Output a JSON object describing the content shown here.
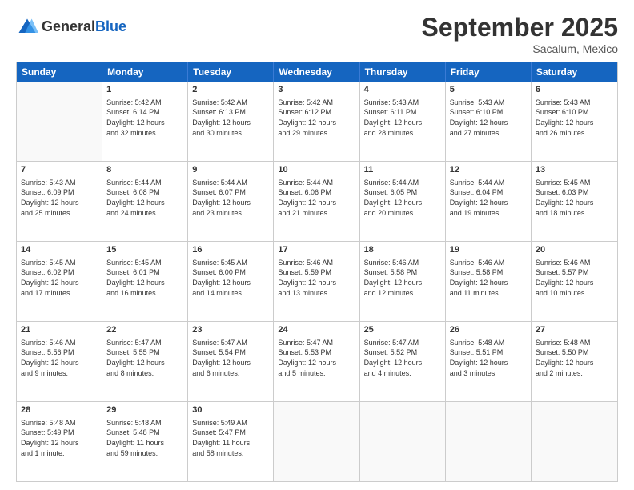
{
  "header": {
    "logo_line1": "General",
    "logo_line2": "Blue",
    "month": "September 2025",
    "location": "Sacalum, Mexico"
  },
  "days_of_week": [
    "Sunday",
    "Monday",
    "Tuesday",
    "Wednesday",
    "Thursday",
    "Friday",
    "Saturday"
  ],
  "weeks": [
    [
      {
        "day": "",
        "info": ""
      },
      {
        "day": "1",
        "info": "Sunrise: 5:42 AM\nSunset: 6:14 PM\nDaylight: 12 hours\nand 32 minutes."
      },
      {
        "day": "2",
        "info": "Sunrise: 5:42 AM\nSunset: 6:13 PM\nDaylight: 12 hours\nand 30 minutes."
      },
      {
        "day": "3",
        "info": "Sunrise: 5:42 AM\nSunset: 6:12 PM\nDaylight: 12 hours\nand 29 minutes."
      },
      {
        "day": "4",
        "info": "Sunrise: 5:43 AM\nSunset: 6:11 PM\nDaylight: 12 hours\nand 28 minutes."
      },
      {
        "day": "5",
        "info": "Sunrise: 5:43 AM\nSunset: 6:10 PM\nDaylight: 12 hours\nand 27 minutes."
      },
      {
        "day": "6",
        "info": "Sunrise: 5:43 AM\nSunset: 6:10 PM\nDaylight: 12 hours\nand 26 minutes."
      }
    ],
    [
      {
        "day": "7",
        "info": "Sunrise: 5:43 AM\nSunset: 6:09 PM\nDaylight: 12 hours\nand 25 minutes."
      },
      {
        "day": "8",
        "info": "Sunrise: 5:44 AM\nSunset: 6:08 PM\nDaylight: 12 hours\nand 24 minutes."
      },
      {
        "day": "9",
        "info": "Sunrise: 5:44 AM\nSunset: 6:07 PM\nDaylight: 12 hours\nand 23 minutes."
      },
      {
        "day": "10",
        "info": "Sunrise: 5:44 AM\nSunset: 6:06 PM\nDaylight: 12 hours\nand 21 minutes."
      },
      {
        "day": "11",
        "info": "Sunrise: 5:44 AM\nSunset: 6:05 PM\nDaylight: 12 hours\nand 20 minutes."
      },
      {
        "day": "12",
        "info": "Sunrise: 5:44 AM\nSunset: 6:04 PM\nDaylight: 12 hours\nand 19 minutes."
      },
      {
        "day": "13",
        "info": "Sunrise: 5:45 AM\nSunset: 6:03 PM\nDaylight: 12 hours\nand 18 minutes."
      }
    ],
    [
      {
        "day": "14",
        "info": "Sunrise: 5:45 AM\nSunset: 6:02 PM\nDaylight: 12 hours\nand 17 minutes."
      },
      {
        "day": "15",
        "info": "Sunrise: 5:45 AM\nSunset: 6:01 PM\nDaylight: 12 hours\nand 16 minutes."
      },
      {
        "day": "16",
        "info": "Sunrise: 5:45 AM\nSunset: 6:00 PM\nDaylight: 12 hours\nand 14 minutes."
      },
      {
        "day": "17",
        "info": "Sunrise: 5:46 AM\nSunset: 5:59 PM\nDaylight: 12 hours\nand 13 minutes."
      },
      {
        "day": "18",
        "info": "Sunrise: 5:46 AM\nSunset: 5:58 PM\nDaylight: 12 hours\nand 12 minutes."
      },
      {
        "day": "19",
        "info": "Sunrise: 5:46 AM\nSunset: 5:58 PM\nDaylight: 12 hours\nand 11 minutes."
      },
      {
        "day": "20",
        "info": "Sunrise: 5:46 AM\nSunset: 5:57 PM\nDaylight: 12 hours\nand 10 minutes."
      }
    ],
    [
      {
        "day": "21",
        "info": "Sunrise: 5:46 AM\nSunset: 5:56 PM\nDaylight: 12 hours\nand 9 minutes."
      },
      {
        "day": "22",
        "info": "Sunrise: 5:47 AM\nSunset: 5:55 PM\nDaylight: 12 hours\nand 8 minutes."
      },
      {
        "day": "23",
        "info": "Sunrise: 5:47 AM\nSunset: 5:54 PM\nDaylight: 12 hours\nand 6 minutes."
      },
      {
        "day": "24",
        "info": "Sunrise: 5:47 AM\nSunset: 5:53 PM\nDaylight: 12 hours\nand 5 minutes."
      },
      {
        "day": "25",
        "info": "Sunrise: 5:47 AM\nSunset: 5:52 PM\nDaylight: 12 hours\nand 4 minutes."
      },
      {
        "day": "26",
        "info": "Sunrise: 5:48 AM\nSunset: 5:51 PM\nDaylight: 12 hours\nand 3 minutes."
      },
      {
        "day": "27",
        "info": "Sunrise: 5:48 AM\nSunset: 5:50 PM\nDaylight: 12 hours\nand 2 minutes."
      }
    ],
    [
      {
        "day": "28",
        "info": "Sunrise: 5:48 AM\nSunset: 5:49 PM\nDaylight: 12 hours\nand 1 minute."
      },
      {
        "day": "29",
        "info": "Sunrise: 5:48 AM\nSunset: 5:48 PM\nDaylight: 11 hours\nand 59 minutes."
      },
      {
        "day": "30",
        "info": "Sunrise: 5:49 AM\nSunset: 5:47 PM\nDaylight: 11 hours\nand 58 minutes."
      },
      {
        "day": "",
        "info": ""
      },
      {
        "day": "",
        "info": ""
      },
      {
        "day": "",
        "info": ""
      },
      {
        "day": "",
        "info": ""
      }
    ]
  ]
}
